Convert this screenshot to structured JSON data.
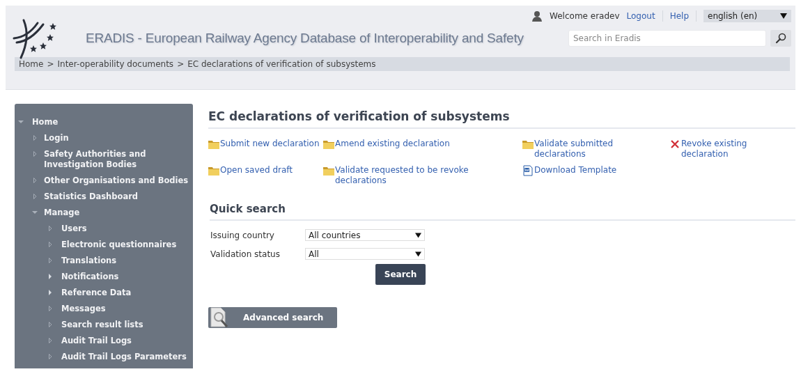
{
  "header": {
    "welcome": "Welcome eradev",
    "links": [
      "Logout",
      "Help"
    ],
    "language": "english (en)",
    "title": "ERADIS - European Railway Agency Database of Interoperability and Safety",
    "search": {
      "placeholder": "Search in Eradis"
    }
  },
  "breadcrumb": [
    "Home",
    "Inter-operability documents",
    "EC declarations of verification of subsystems"
  ],
  "breadcrumb_separator": ">",
  "sidebar": {
    "items": [
      {
        "label": "Home",
        "expanded": true,
        "children": [
          {
            "label": "Login",
            "has_children": false
          },
          {
            "label": "Safety Authorities and Investigation Bodies",
            "has_children": false
          },
          {
            "label": "Other Organisations and Bodies",
            "has_children": false
          },
          {
            "label": "Statistics Dashboard",
            "has_children": false
          },
          {
            "label": "Manage",
            "expanded": true,
            "children": [
              {
                "label": "Users",
                "has_children": false
              },
              {
                "label": "Electronic questionnaires",
                "has_children": false
              },
              {
                "label": "Translations",
                "has_children": false
              },
              {
                "label": "Notifications",
                "has_children": true
              },
              {
                "label": "Reference Data",
                "has_children": true
              },
              {
                "label": "Messages",
                "has_children": false
              },
              {
                "label": "Search result lists",
                "has_children": false
              },
              {
                "label": "Audit Trail Logs",
                "has_children": false
              },
              {
                "label": "Audit Trail Logs Parameters",
                "has_children": false
              }
            ]
          }
        ]
      }
    ]
  },
  "page_title": "EC declarations of verification of subsystems",
  "actions": [
    {
      "label": "Submit new declaration",
      "kind": "folder"
    },
    {
      "label": "Amend existing declaration",
      "kind": "folder"
    },
    {
      "label": "Validate submitted declarations",
      "kind": "folder"
    },
    {
      "label": "Revoke existing declaration",
      "kind": "cross"
    },
    {
      "label": "Open saved draft",
      "kind": "folder"
    },
    {
      "label": "Validate requested to be revoke declarations",
      "kind": "folder"
    },
    {
      "label": "Download Template",
      "kind": "document"
    }
  ],
  "quick_search": {
    "title": "Quick search",
    "fields": [
      {
        "label": "Issuing country",
        "value": "All countries"
      },
      {
        "label": "Validation status",
        "value": "All"
      }
    ],
    "button": "Search"
  },
  "advanced_search": "Advanced search"
}
